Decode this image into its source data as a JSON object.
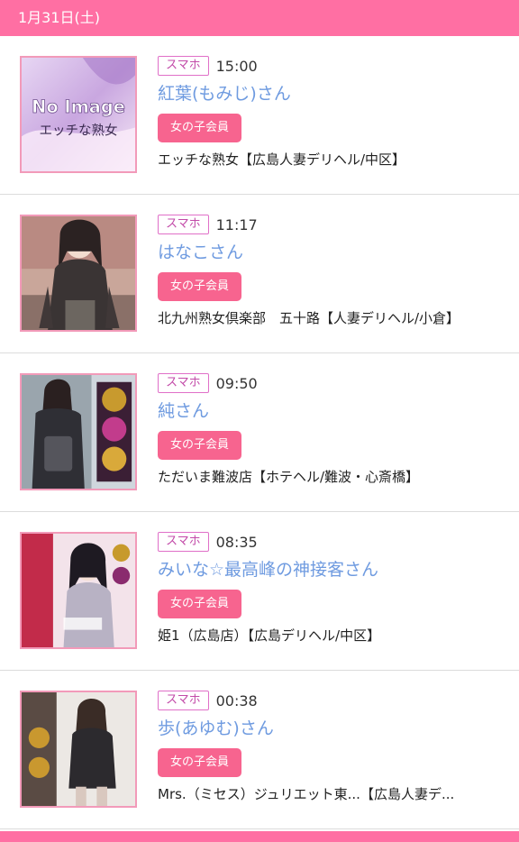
{
  "header": {
    "date": "1月31日(土)"
  },
  "entries": [
    {
      "device": "スマホ",
      "time": "15:00",
      "name": "紅葉(もみじ)さん",
      "badge": "女の子会員",
      "shop": "エッチな熟女【広島人妻デリヘル/中区】",
      "thumb": {
        "text1": "No Image",
        "text2": "エッチな熟女"
      }
    },
    {
      "device": "スマホ",
      "time": "11:17",
      "name": "はなこさん",
      "badge": "女の子会員",
      "shop": "北九州熟女倶楽部　五十路【人妻デリヘル/小倉】"
    },
    {
      "device": "スマホ",
      "time": "09:50",
      "name": "純さん",
      "badge": "女の子会員",
      "shop": "ただいま難波店【ホテヘル/難波・心斎橋】"
    },
    {
      "device": "スマホ",
      "time": "08:35",
      "name": "みいな☆最高峰の神接客さん",
      "badge": "女の子会員",
      "shop": "姫1（広島店）【広島デリヘル/中区】"
    },
    {
      "device": "スマホ",
      "time": "00:38",
      "name": "歩(あゆむ)さん",
      "badge": "女の子会員",
      "shop": "Mrs.（ミセス）ジュリエット東...【広島人妻デ..."
    }
  ]
}
